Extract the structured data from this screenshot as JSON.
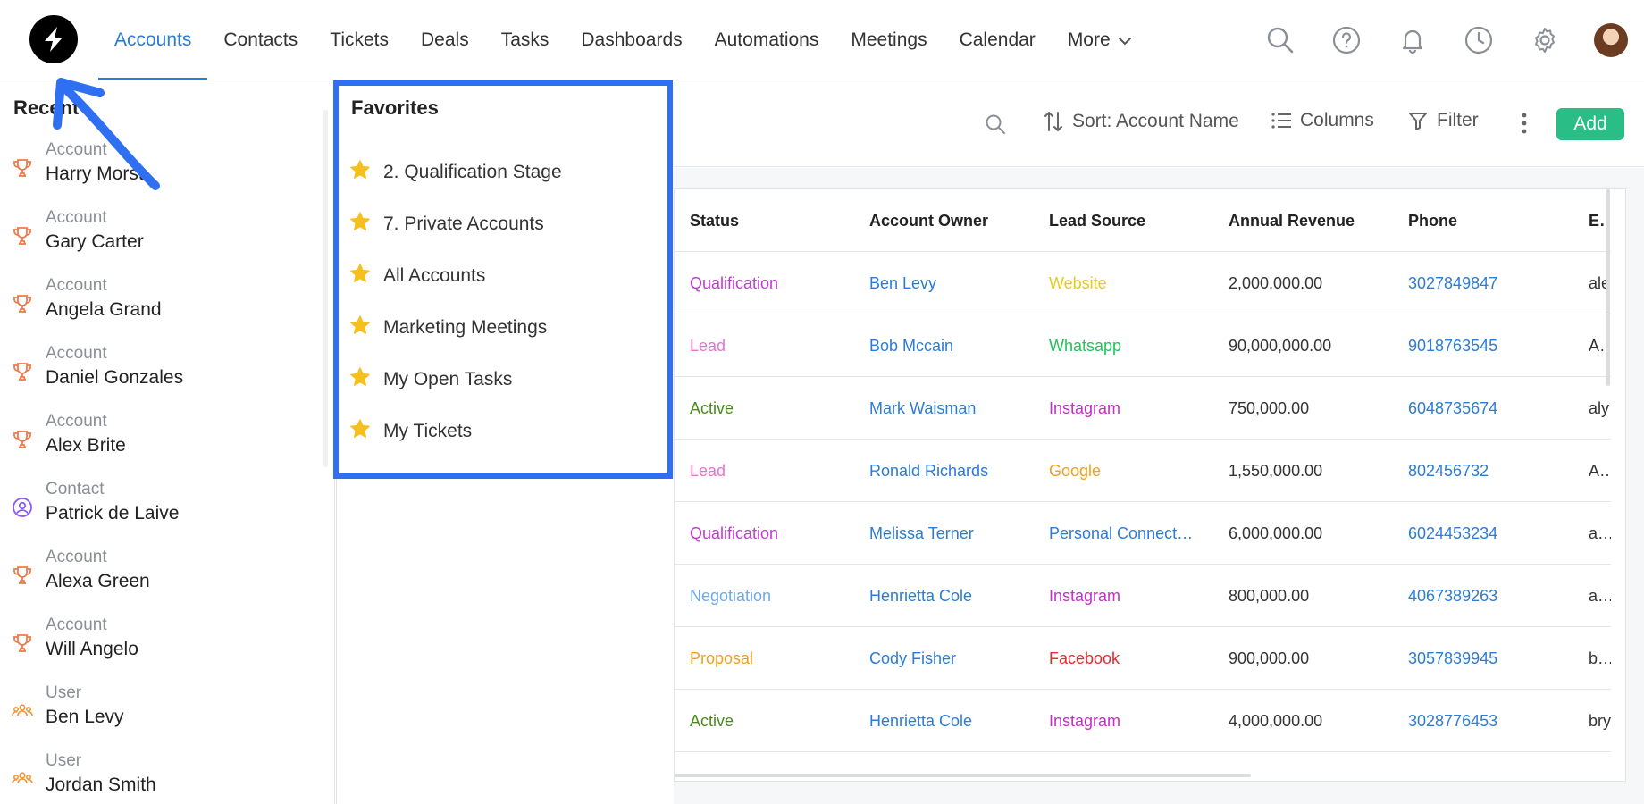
{
  "nav": {
    "items": [
      {
        "label": "Accounts",
        "active": true
      },
      {
        "label": "Contacts"
      },
      {
        "label": "Tickets"
      },
      {
        "label": "Deals"
      },
      {
        "label": "Tasks"
      },
      {
        "label": "Dashboards"
      },
      {
        "label": "Automations"
      },
      {
        "label": "Meetings"
      },
      {
        "label": "Calendar"
      }
    ],
    "more_label": "More",
    "icons": [
      "search-icon",
      "help-icon",
      "bell-icon",
      "history-icon",
      "gear-icon",
      "avatar"
    ]
  },
  "recent": {
    "title": "Recent",
    "items": [
      {
        "type": "Account",
        "name": "Harry Morst",
        "icon": "trophy-icon"
      },
      {
        "type": "Account",
        "name": "Gary Carter",
        "icon": "trophy-icon"
      },
      {
        "type": "Account",
        "name": "Angela Grand",
        "icon": "trophy-icon"
      },
      {
        "type": "Account",
        "name": "Daniel Gonzales",
        "icon": "trophy-icon"
      },
      {
        "type": "Account",
        "name": "Alex Brite",
        "icon": "trophy-icon"
      },
      {
        "type": "Contact",
        "name": "Patrick de Laive",
        "icon": "contact-icon"
      },
      {
        "type": "Account",
        "name": "Alexa Green",
        "icon": "trophy-icon"
      },
      {
        "type": "Account",
        "name": "Will Angelo",
        "icon": "trophy-icon"
      },
      {
        "type": "User",
        "name": "Ben Levy",
        "icon": "users-icon"
      },
      {
        "type": "User",
        "name": "Jordan Smith",
        "icon": "users-icon"
      }
    ]
  },
  "favorites": {
    "title": "Favorites",
    "items": [
      "2. Qualification Stage",
      "7. Private Accounts",
      "All Accounts",
      "Marketing Meetings",
      "My Open Tasks",
      "My Tickets"
    ]
  },
  "toolbar": {
    "sort_label": "Sort: Account Name",
    "columns_label": "Columns",
    "filter_label": "Filter",
    "add_label": "Add"
  },
  "table": {
    "headers": {
      "status": "Status",
      "owner": "Account Owner",
      "source": "Lead Source",
      "revenue": "Annual Revenue",
      "phone": "Phone",
      "email": "Em"
    },
    "rows": [
      {
        "status": "Qualification",
        "owner": "Ben Levy",
        "source": "Website",
        "revenue": "2,000,000.00",
        "phone": "3027849847",
        "email": "ale"
      },
      {
        "status": "Lead",
        "owner": "Bob Mccain",
        "source": "Whatsapp",
        "revenue": "90,000,000.00",
        "phone": "9018763545",
        "email": "AG"
      },
      {
        "status": "Active",
        "owner": "Mark Waisman",
        "source": "Instagram",
        "revenue": "750,000.00",
        "phone": "6048735674",
        "email": "aly"
      },
      {
        "status": "Lead",
        "owner": "Ronald Richards",
        "source": "Google",
        "revenue": "1,550,000.00",
        "phone": "802456732",
        "email": "Am"
      },
      {
        "status": "Qualification",
        "owner": "Melissa Terner",
        "source": "Personal Connect…",
        "revenue": "6,000,000.00",
        "phone": "6024453234",
        "email": "and"
      },
      {
        "status": "Negotiation",
        "owner": "Henrietta Cole",
        "source": "Instagram",
        "revenue": "800,000.00",
        "phone": "4067389263",
        "email": "ang"
      },
      {
        "status": "Proposal",
        "owner": "Cody Fisher",
        "source": "Facebook",
        "revenue": "900,000.00",
        "phone": "3057839945",
        "email": "bar"
      },
      {
        "status": "Active",
        "owner": "Henrietta Cole",
        "source": "Instagram",
        "revenue": "4,000,000.00",
        "phone": "3028776453",
        "email": "bry"
      }
    ]
  },
  "colors": {
    "status": {
      "Qualification": "#c23ad6",
      "Lead": "#e873c9",
      "Active": "#4a8a1a",
      "Negotiation": "#6fa8e8",
      "Proposal": "#f0a020"
    },
    "source": {
      "Website": "#e6cc1a",
      "Whatsapp": "#1fc45a",
      "Instagram": "#c42fc4",
      "Google": "#f0a020",
      "Personal Connect…": "#2b7bd9",
      "Facebook": "#e8282f"
    },
    "accent": "#2b7bd9",
    "add_button": "#2bbd86",
    "highlight": "#2f6ff2"
  }
}
